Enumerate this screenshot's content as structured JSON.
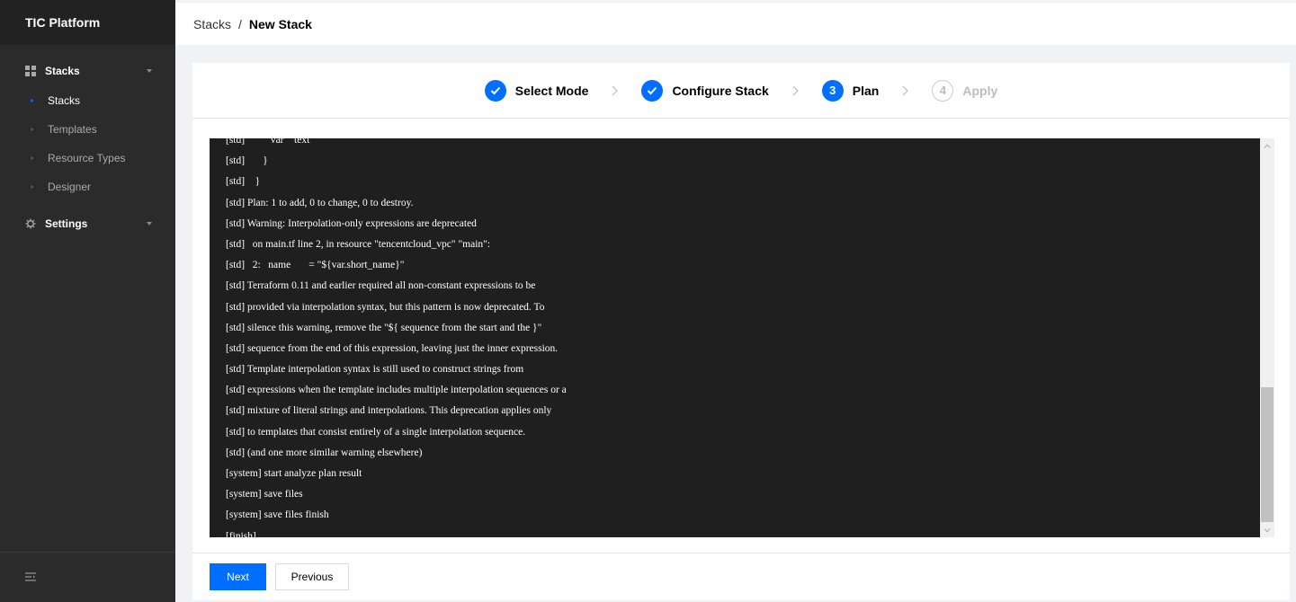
{
  "app": {
    "title": "TIC Platform"
  },
  "sidebar": {
    "groups": [
      {
        "label": "Stacks",
        "icon": "grid-icon",
        "items": [
          {
            "label": "Stacks",
            "active": true
          },
          {
            "label": "Templates"
          },
          {
            "label": "Resource Types"
          },
          {
            "label": "Designer"
          }
        ]
      },
      {
        "label": "Settings",
        "icon": "gear-icon"
      }
    ],
    "footer_icon": "collapse-menu-icon"
  },
  "breadcrumb": {
    "parent": "Stacks",
    "separator": "/",
    "current": "New Stack"
  },
  "steps": [
    {
      "label": "Select Mode",
      "state": "done"
    },
    {
      "label": "Configure Stack",
      "state": "done"
    },
    {
      "number": "3",
      "label": "Plan",
      "state": "active"
    },
    {
      "number": "4",
      "label": "Apply",
      "state": "pending"
    }
  ],
  "console": {
    "lines": [
      "[std]          var    text",
      "[std]       }",
      "[std]    }",
      "[std] Plan: 1 to add, 0 to change, 0 to destroy.",
      "[std] Warning: Interpolation-only expressions are deprecated",
      "[std]   on main.tf line 2, in resource \"tencentcloud_vpc\" \"main\":",
      "[std]   2:   name       = \"${var.short_name}\"",
      "[std] Terraform 0.11 and earlier required all non-constant expressions to be",
      "[std] provided via interpolation syntax, but this pattern is now deprecated. To",
      "[std] silence this warning, remove the \"${ sequence from the start and the }\"",
      "[std] sequence from the end of this expression, leaving just the inner expression.",
      "[std] Template interpolation syntax is still used to construct strings from",
      "[std] expressions when the template includes multiple interpolation sequences or a",
      "[std] mixture of literal strings and interpolations. This deprecation applies only",
      "[std] to templates that consist entirely of a single interpolation sequence.",
      "[std] (and one more similar warning elsewhere)",
      "[system] start analyze plan result",
      "[system] save files",
      "[system] save files finish",
      "[finish]"
    ]
  },
  "footer": {
    "next_label": "Next",
    "previous_label": "Previous"
  },
  "colors": {
    "accent": "#006eff",
    "sidebar_bg": "#2b2b2b",
    "console_bg": "#1f1f1f"
  }
}
